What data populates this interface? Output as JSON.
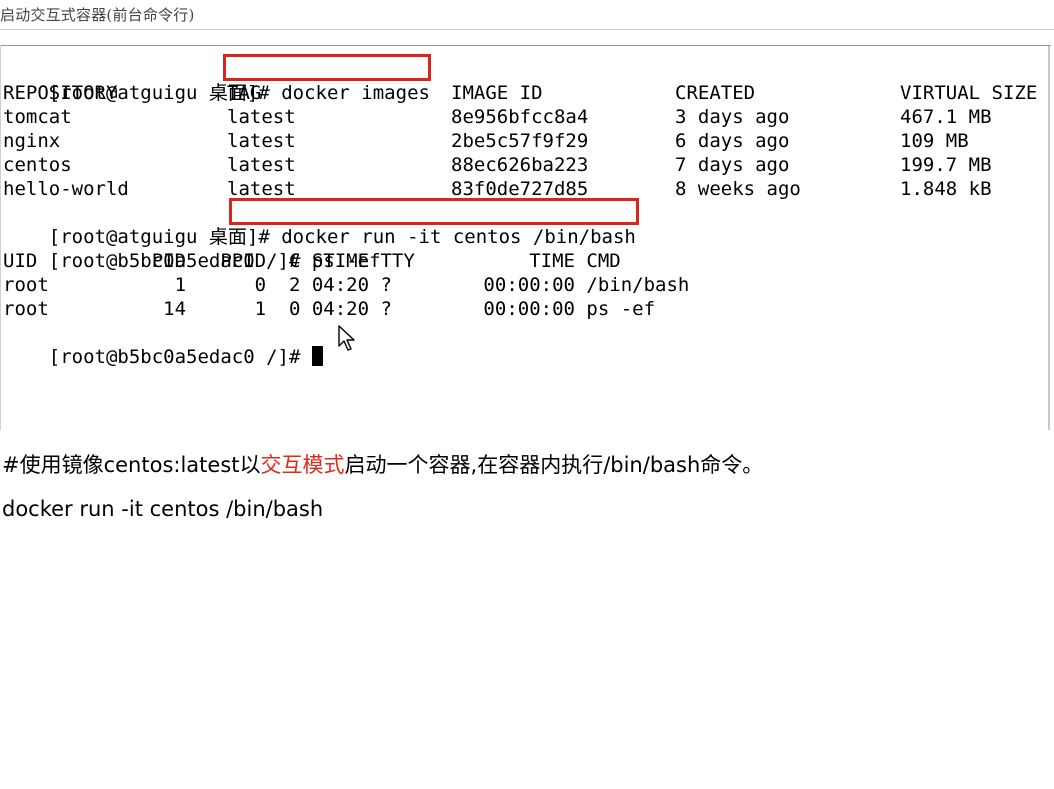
{
  "header": {
    "title": "启动交互式容器(前台命令行)"
  },
  "terminal": {
    "prompt1": "[root@atguigu 桌面]# ",
    "cmd1": "docker images",
    "images_table": {
      "headers": [
        "REPOSITORY",
        "TAG",
        "IMAGE ID",
        "CREATED",
        "VIRTUAL SIZE"
      ],
      "rows": [
        [
          "tomcat",
          "latest",
          "8e956bfcc8a4",
          "3 days ago",
          "467.1 MB"
        ],
        [
          "nginx",
          "latest",
          "2be5c57f9f29",
          "6 days ago",
          "109 MB"
        ],
        [
          "centos",
          "latest",
          "88ec626ba223",
          "7 days ago",
          "199.7 MB"
        ],
        [
          "hello-world",
          "latest",
          "83f0de727d85",
          "8 weeks ago",
          "1.848 kB"
        ]
      ]
    },
    "prompt2": "[root@atguigu 桌面]# ",
    "cmd2": "docker run -it centos /bin/bash",
    "prompt3": "[root@b5bc0a5edac0 /]# ",
    "cmd3": "ps -ef",
    "ps_table": {
      "header": "UID          PID   PPID  C STIME TTY          TIME CMD",
      "rows": [
        "root           1      0  2 04:20 ?        00:00:00 /bin/bash",
        "root          14      1  0 04:20 ?        00:00:00 ps -ef"
      ]
    },
    "prompt4": "[root@b5bc0a5edac0 /]# "
  },
  "description": {
    "part1": "#使用镜像centos:latest以",
    "part2": "交互模式",
    "part3": "启动一个容器,在容器内执行/bin/bash命令。"
  },
  "command_line": "docker run -it centos /bin/bash",
  "colors": {
    "highlight": "#d9261c",
    "emphasis": "#e02a1a"
  }
}
